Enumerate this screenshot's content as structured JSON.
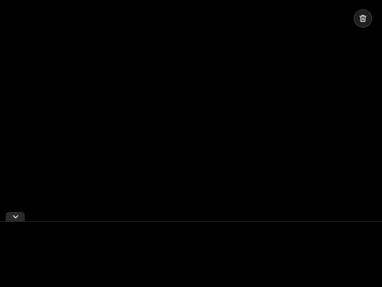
{
  "colors": {
    "background": "#000000",
    "button_bg": "#1f1f1f",
    "icon": "#e6e6e6",
    "tab_bg": "#2a2a2a",
    "divider": "#1c1c1c"
  },
  "toolbar": {
    "delete_icon": "trash-icon"
  },
  "panel": {
    "toggle_icon": "chevron-down-icon"
  }
}
